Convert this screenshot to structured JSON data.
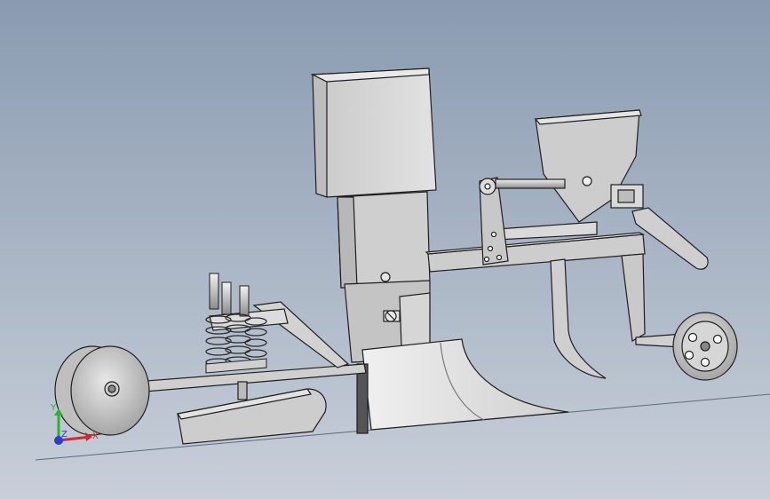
{
  "viewport": {
    "background_top": "#8a9bb1",
    "background_bottom": "#c8cfd9"
  },
  "model": {
    "part_fill": "#d7d7d7",
    "part_shadow": "#a9a9a9",
    "edge_color": "#1e1e1e"
  },
  "triad": {
    "x_label": "X",
    "y_label": "Y",
    "z_label": "Z",
    "x_color": "#d22a2a",
    "y_color": "#2fb02f",
    "z_color": "#2a3fd2"
  }
}
